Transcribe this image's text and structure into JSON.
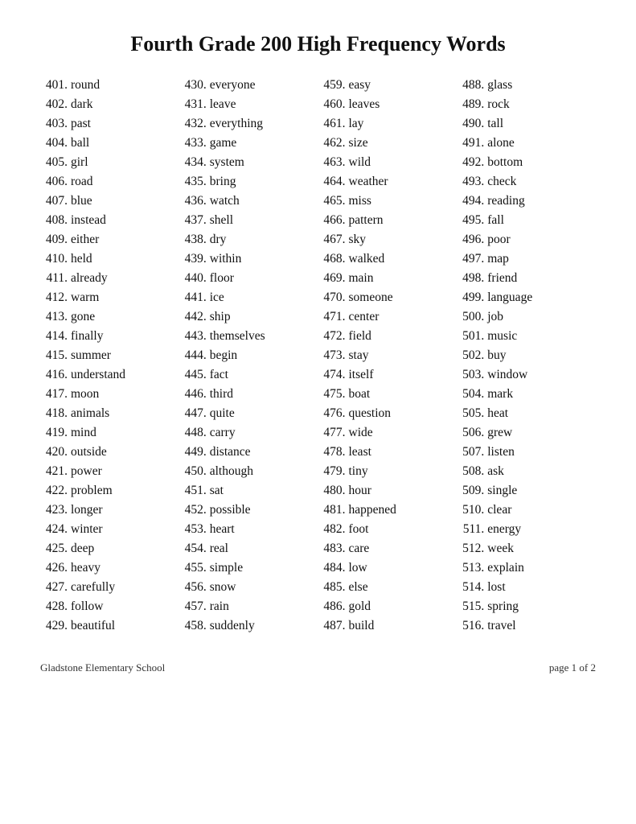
{
  "title": "Fourth Grade 200 High Frequency Words",
  "footer": {
    "left": "Gladstone Elementary School",
    "right": "page 1 of 2"
  },
  "columns": [
    [
      {
        "num": "401.",
        "word": "round"
      },
      {
        "num": "402.",
        "word": "dark"
      },
      {
        "num": "403.",
        "word": "past"
      },
      {
        "num": "404.",
        "word": "ball"
      },
      {
        "num": "405.",
        "word": "girl"
      },
      {
        "num": "406.",
        "word": "road"
      },
      {
        "num": "407.",
        "word": "blue"
      },
      {
        "num": "408.",
        "word": "instead"
      },
      {
        "num": "409.",
        "word": "either"
      },
      {
        "num": "410.",
        "word": "held"
      },
      {
        "num": "411.",
        "word": "already"
      },
      {
        "num": "412.",
        "word": "warm"
      },
      {
        "num": "413.",
        "word": "gone"
      },
      {
        "num": "414.",
        "word": "finally"
      },
      {
        "num": "415.",
        "word": "summer"
      },
      {
        "num": "416.",
        "word": "understand"
      },
      {
        "num": "417.",
        "word": "moon"
      },
      {
        "num": "418.",
        "word": "animals"
      },
      {
        "num": "419.",
        "word": "mind"
      },
      {
        "num": "420.",
        "word": "outside"
      },
      {
        "num": "421.",
        "word": "power"
      },
      {
        "num": "422.",
        "word": "problem"
      },
      {
        "num": "423.",
        "word": "longer"
      },
      {
        "num": "424.",
        "word": "winter"
      },
      {
        "num": "425.",
        "word": "deep"
      },
      {
        "num": "426.",
        "word": "heavy"
      },
      {
        "num": "427.",
        "word": "carefully"
      },
      {
        "num": "428.",
        "word": "follow"
      },
      {
        "num": "429.",
        "word": "beautiful"
      }
    ],
    [
      {
        "num": "430.",
        "word": "everyone"
      },
      {
        "num": "431.",
        "word": "leave"
      },
      {
        "num": "432.",
        "word": "everything"
      },
      {
        "num": "433.",
        "word": "game"
      },
      {
        "num": "434.",
        "word": "system"
      },
      {
        "num": "435.",
        "word": "bring"
      },
      {
        "num": "436.",
        "word": "watch"
      },
      {
        "num": "437.",
        "word": "shell"
      },
      {
        "num": "438.",
        "word": "dry"
      },
      {
        "num": "439.",
        "word": "within"
      },
      {
        "num": "440.",
        "word": "floor"
      },
      {
        "num": "441.",
        "word": "ice"
      },
      {
        "num": "442.",
        "word": "ship"
      },
      {
        "num": "443.",
        "word": "themselves"
      },
      {
        "num": "444.",
        "word": "begin"
      },
      {
        "num": "445.",
        "word": "fact"
      },
      {
        "num": "446.",
        "word": "third"
      },
      {
        "num": "447.",
        "word": "quite"
      },
      {
        "num": "448.",
        "word": "carry"
      },
      {
        "num": "449.",
        "word": "distance"
      },
      {
        "num": "450.",
        "word": "although"
      },
      {
        "num": "451.",
        "word": "sat"
      },
      {
        "num": "452.",
        "word": "possible"
      },
      {
        "num": "453.",
        "word": "heart"
      },
      {
        "num": "454.",
        "word": "real"
      },
      {
        "num": "455.",
        "word": "simple"
      },
      {
        "num": "456.",
        "word": "snow"
      },
      {
        "num": "457.",
        "word": "rain"
      },
      {
        "num": "458.",
        "word": "suddenly"
      }
    ],
    [
      {
        "num": "459.",
        "word": "easy"
      },
      {
        "num": "460.",
        "word": "leaves"
      },
      {
        "num": "461.",
        "word": "lay"
      },
      {
        "num": "462.",
        "word": "size"
      },
      {
        "num": "463.",
        "word": "wild"
      },
      {
        "num": "464.",
        "word": "weather"
      },
      {
        "num": "465.",
        "word": "miss"
      },
      {
        "num": "466.",
        "word": "pattern"
      },
      {
        "num": "467.",
        "word": "sky"
      },
      {
        "num": "468.",
        "word": "walked"
      },
      {
        "num": "469.",
        "word": "main"
      },
      {
        "num": "470.",
        "word": "someone"
      },
      {
        "num": "471.",
        "word": "center"
      },
      {
        "num": "472.",
        "word": "field"
      },
      {
        "num": "473.",
        "word": "stay"
      },
      {
        "num": "474.",
        "word": "itself"
      },
      {
        "num": "475.",
        "word": "boat"
      },
      {
        "num": "476.",
        "word": "question"
      },
      {
        "num": "477.",
        "word": "wide"
      },
      {
        "num": "478.",
        "word": "least"
      },
      {
        "num": "479.",
        "word": "tiny"
      },
      {
        "num": "480.",
        "word": "hour"
      },
      {
        "num": "481.",
        "word": "happened"
      },
      {
        "num": "482.",
        "word": "foot"
      },
      {
        "num": "483.",
        "word": "care"
      },
      {
        "num": "484.",
        "word": "low"
      },
      {
        "num": "485.",
        "word": "else"
      },
      {
        "num": "486.",
        "word": "gold"
      },
      {
        "num": "487.",
        "word": "build"
      }
    ],
    [
      {
        "num": "488.",
        "word": "glass"
      },
      {
        "num": "489.",
        "word": "rock"
      },
      {
        "num": "490.",
        "word": "tall"
      },
      {
        "num": "491.",
        "word": "alone"
      },
      {
        "num": "492.",
        "word": "bottom"
      },
      {
        "num": "493.",
        "word": "check"
      },
      {
        "num": "494.",
        "word": "reading"
      },
      {
        "num": "495.",
        "word": "fall"
      },
      {
        "num": "496.",
        "word": "poor"
      },
      {
        "num": "497.",
        "word": "map"
      },
      {
        "num": "498.",
        "word": "friend"
      },
      {
        "num": "499.",
        "word": "language"
      },
      {
        "num": "500.",
        "word": "job"
      },
      {
        "num": "501.",
        "word": "music"
      },
      {
        "num": "502.",
        "word": "buy"
      },
      {
        "num": "503.",
        "word": "window"
      },
      {
        "num": "504.",
        "word": "mark"
      },
      {
        "num": "505.",
        "word": "heat"
      },
      {
        "num": "506.",
        "word": "grew"
      },
      {
        "num": "507.",
        "word": "listen"
      },
      {
        "num": "508.",
        "word": "ask"
      },
      {
        "num": "509.",
        "word": "single"
      },
      {
        "num": "510.",
        "word": "clear"
      },
      {
        "num": "511.",
        "word": "energy"
      },
      {
        "num": "512.",
        "word": "week"
      },
      {
        "num": "513.",
        "word": "explain"
      },
      {
        "num": "514.",
        "word": "lost"
      },
      {
        "num": "515.",
        "word": "spring"
      },
      {
        "num": "516.",
        "word": "travel"
      }
    ]
  ]
}
